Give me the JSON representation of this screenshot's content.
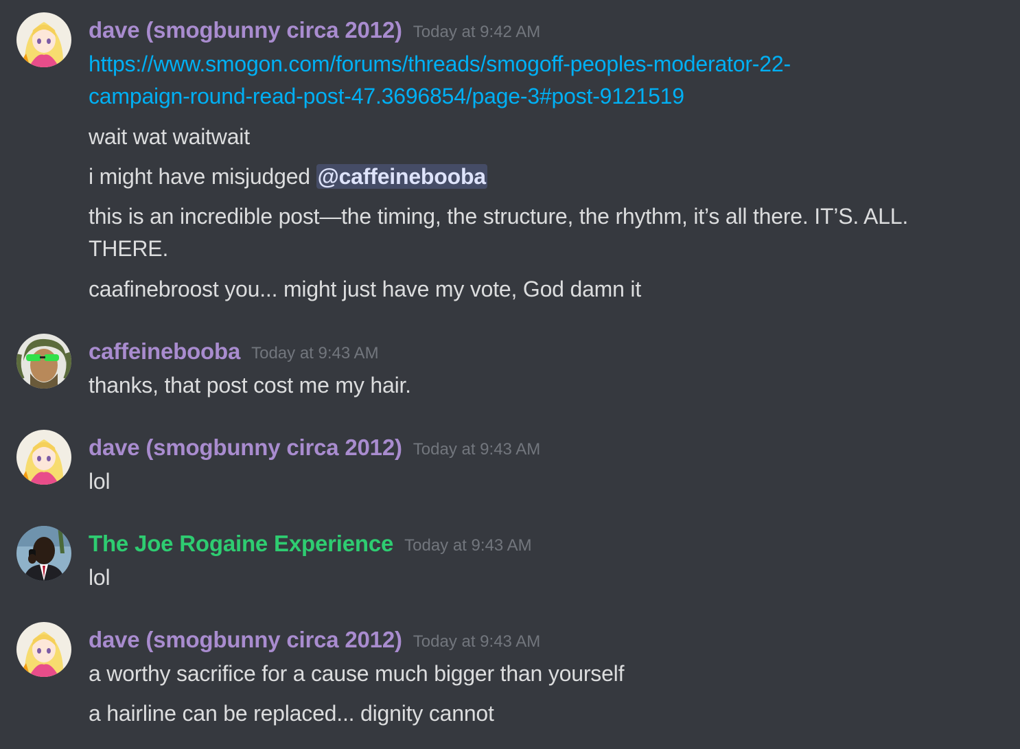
{
  "colors": {
    "background": "#36393f",
    "dave_name": "#a98ccf",
    "joe_name": "#2ecc71",
    "caffeine_name": "#a98ccf",
    "timestamp": "#72767d",
    "link": "#00b0f4",
    "text": "#dcddde"
  },
  "messages": [
    {
      "author": "dave (smogbunny circa 2012)",
      "timestamp": "Today at 9:42 AM",
      "avatar": "anime-girl-avatar",
      "lines": {
        "link_line1": "https://www.smogon.com/forums/threads/smogoff-peoples-moderator-22-",
        "link_line2": "campaign-round-read-post-47.3696854/page-3#post-9121519",
        "l1": "wait wat waitwait",
        "l2_prefix": "i might have misjudged ",
        "l2_mention": "@caffeinebooba",
        "l3a": "this is an incredible post—the timing, the structure, the rhythm, it’s all there. IT’S. ALL.",
        "l3b": "THERE.",
        "l4": "caafinebroost you... might just have my vote, God damn it"
      }
    },
    {
      "author": "caffeinebooba",
      "timestamp": "Today at 9:43 AM",
      "avatar": "man-with-green-sunglasses-avatar",
      "lines": {
        "l1": "thanks, that post cost me my hair."
      }
    },
    {
      "author": "dave (smogbunny circa 2012)",
      "timestamp": "Today at 9:43 AM",
      "avatar": "anime-girl-avatar",
      "lines": {
        "l1": "lol"
      }
    },
    {
      "author": "The Joe Rogaine Experience",
      "timestamp": "Today at 9:43 AM",
      "avatar": "man-on-phone-avatar",
      "lines": {
        "l1": "lol"
      }
    },
    {
      "author": "dave (smogbunny circa 2012)",
      "timestamp": "Today at 9:43 AM",
      "avatar": "anime-girl-avatar",
      "lines": {
        "l1": "a worthy sacrifice for a cause much bigger than yourself",
        "l2": "a hairline can be replaced... dignity cannot"
      }
    }
  ]
}
